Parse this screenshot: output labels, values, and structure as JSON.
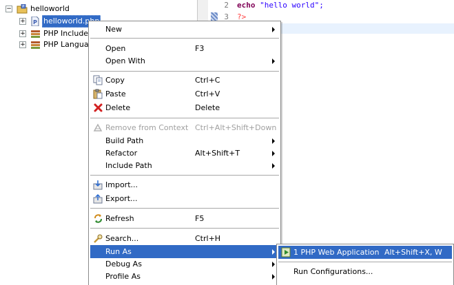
{
  "tree": {
    "project": {
      "label": "helloworld",
      "expander": "−",
      "icon": "php-project-icon"
    },
    "items": [
      {
        "label": "helloworld.php",
        "expander": "+",
        "icon": "php-file-icon",
        "selected": true
      },
      {
        "label": "PHP Include P",
        "expander": "+",
        "icon": "library-icon"
      },
      {
        "label": "PHP Language",
        "expander": "+",
        "icon": "library-icon"
      }
    ]
  },
  "editor": {
    "lines": [
      {
        "number": "2",
        "keyword": "echo",
        "string": " \"hello world\";"
      },
      {
        "number": "3",
        "tag": "?>"
      }
    ]
  },
  "context_menu": {
    "items": [
      {
        "label": "New"
      },
      {
        "label": "Open",
        "accel": "F3"
      },
      {
        "label": "Open With"
      },
      {
        "label": "Copy",
        "accel": "Ctrl+C"
      },
      {
        "label": "Paste",
        "accel": "Ctrl+V"
      },
      {
        "label": "Delete",
        "accel": "Delete"
      },
      {
        "label": "Remove from Context",
        "accel": "Ctrl+Alt+Shift+Down"
      },
      {
        "label": "Build Path"
      },
      {
        "label": "Refactor",
        "accel": "Alt+Shift+T"
      },
      {
        "label": "Include Path"
      },
      {
        "label": "Import..."
      },
      {
        "label": "Export..."
      },
      {
        "label": "Refresh",
        "accel": "F5"
      },
      {
        "label": "Search...",
        "accel": "Ctrl+H"
      },
      {
        "label": "Run As"
      },
      {
        "label": "Debug As"
      },
      {
        "label": "Profile As"
      }
    ]
  },
  "run_as_submenu": {
    "items": [
      {
        "label": "1 PHP Web Application",
        "accel": "Alt+Shift+X, W"
      },
      {
        "label": "Run Configurations..."
      }
    ]
  },
  "colors": {
    "highlight": "#316ac5",
    "keyword": "#7f0055",
    "string": "#2a00ff",
    "php_tag": "#ff4040"
  }
}
